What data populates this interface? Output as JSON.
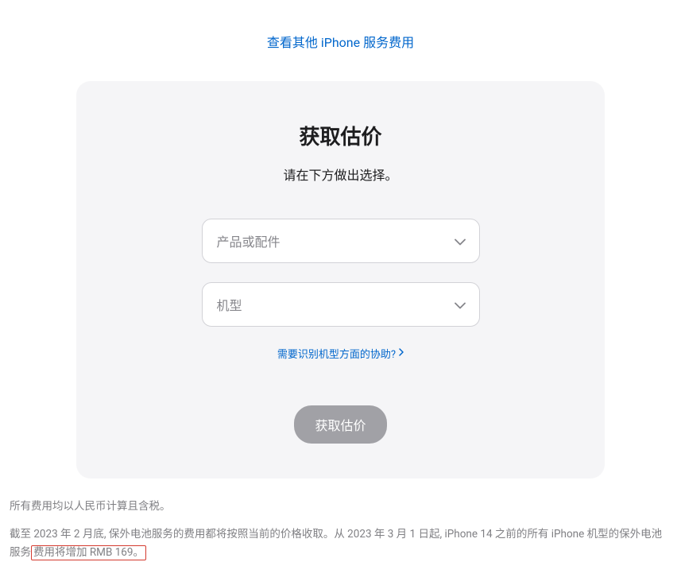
{
  "topLink": "查看其他 iPhone 服务费用",
  "card": {
    "title": "获取估价",
    "subtitle": "请在下方做出选择。",
    "select1_placeholder": "产品或配件",
    "select2_placeholder": "机型",
    "helpLink": "需要识别机型方面的协助?",
    "submitLabel": "获取估价"
  },
  "footer": {
    "line1": "所有费用均以人民币计算且含税。",
    "line2_part1": "截至 2023 年 2 月底, 保外电池服务的费用都将按照当前的价格收取。从 2023 年 3 月 1 日起, iPhone 14 之前的所有 iPhone 机型的保外电池服务",
    "line2_highlight": "费用将增加 RMB 169。"
  }
}
